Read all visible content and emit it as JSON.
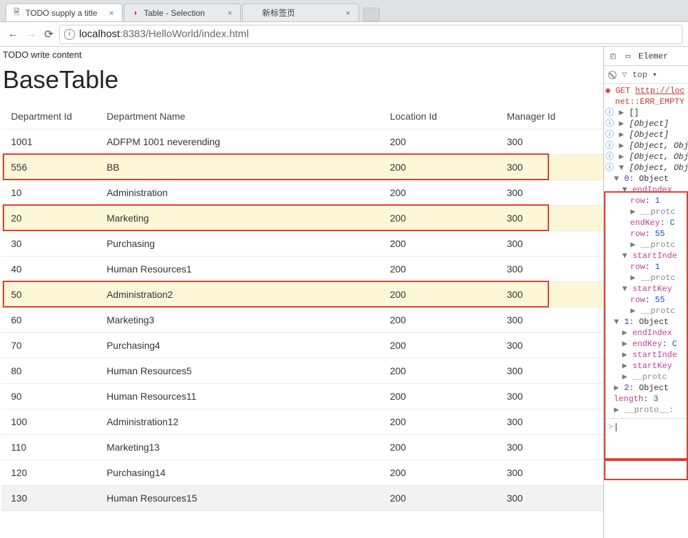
{
  "browser": {
    "tabs": [
      {
        "title": "TODO supply a title",
        "favicon": "doc",
        "active": true
      },
      {
        "title": "Table - Selection",
        "favicon": "oracle",
        "active": false
      },
      {
        "title": "新标签页",
        "favicon": "",
        "active": false
      }
    ],
    "url_host": "localhost",
    "url_port": ":8383",
    "url_path": "/HelloWorld/index.html"
  },
  "page": {
    "pre_text": "TODO write content",
    "heading": "BaseTable",
    "columns": [
      "Department Id",
      "Department Name",
      "Location Id",
      "Manager Id"
    ],
    "rows": [
      {
        "id": "1001",
        "name": "ADFPM 1001 neverending",
        "loc": "200",
        "mgr": "300",
        "selected": false
      },
      {
        "id": "556",
        "name": "BB",
        "loc": "200",
        "mgr": "300",
        "selected": true
      },
      {
        "id": "10",
        "name": "Administration",
        "loc": "200",
        "mgr": "300",
        "selected": false
      },
      {
        "id": "20",
        "name": "Marketing",
        "loc": "200",
        "mgr": "300",
        "selected": true
      },
      {
        "id": "30",
        "name": "Purchasing",
        "loc": "200",
        "mgr": "300",
        "selected": false
      },
      {
        "id": "40",
        "name": "Human Resources1",
        "loc": "200",
        "mgr": "300",
        "selected": false
      },
      {
        "id": "50",
        "name": "Administration2",
        "loc": "200",
        "mgr": "300",
        "selected": true
      },
      {
        "id": "60",
        "name": "Marketing3",
        "loc": "200",
        "mgr": "300",
        "selected": false
      },
      {
        "id": "70",
        "name": "Purchasing4",
        "loc": "200",
        "mgr": "300",
        "selected": false
      },
      {
        "id": "80",
        "name": "Human Resources5",
        "loc": "200",
        "mgr": "300",
        "selected": false
      },
      {
        "id": "90",
        "name": "Human Resources11",
        "loc": "200",
        "mgr": "300",
        "selected": false
      },
      {
        "id": "100",
        "name": "Administration12",
        "loc": "200",
        "mgr": "300",
        "selected": false
      },
      {
        "id": "110",
        "name": "Marketing13",
        "loc": "200",
        "mgr": "300",
        "selected": false
      },
      {
        "id": "120",
        "name": "Purchasing14",
        "loc": "200",
        "mgr": "300",
        "selected": false
      },
      {
        "id": "130",
        "name": "Human Resources15",
        "loc": "200",
        "mgr": "300",
        "selected": false,
        "hovered": true
      }
    ]
  },
  "devtools": {
    "tabs_label": "Elemer",
    "filter_scope": "top",
    "error": {
      "method": "GET",
      "url": "http://loc",
      "net": "net::ERR_EMPTY"
    },
    "lines": [
      {
        "tw": "▶",
        "txt": "[]"
      },
      {
        "tw": "▶",
        "txt": "[Object]",
        "it": true
      },
      {
        "tw": "▶",
        "txt": "[Object]",
        "it": true
      },
      {
        "tw": "▶",
        "txt": "[Object, Obj",
        "it": true
      },
      {
        "tw": "▶",
        "txt": "[Object, Obj",
        "it": true
      }
    ],
    "expanded": {
      "head": "[Object, Obj",
      "obj0": {
        "label": "0: Object",
        "rows": [
          {
            "key": "endIndex",
            "extra": ""
          },
          {
            "key": "row",
            "val": "1"
          },
          {
            "key": "__protc",
            "grey": true
          },
          {
            "key": "endKey",
            "val": "C"
          },
          {
            "key": "row",
            "val": "55"
          },
          {
            "key": "__protc",
            "grey": true
          },
          {
            "key": "startInde",
            "extra": ""
          },
          {
            "key": "row",
            "val": "1"
          },
          {
            "key": "__protc",
            "grey": true
          },
          {
            "key": "startKey",
            "extra": ""
          },
          {
            "key": "row",
            "val": "55"
          },
          {
            "key": "__protc",
            "grey": true
          }
        ]
      },
      "obj1": {
        "label": "1: Object",
        "rows": [
          {
            "key": "endIndex",
            "extra": ""
          },
          {
            "key": "endKey",
            "val": "C"
          },
          {
            "key": "startInde",
            "extra": ""
          },
          {
            "key": "startKey",
            "extra": ""
          },
          {
            "key": "__protc",
            "grey": true
          }
        ]
      },
      "obj2_label": "2: Object",
      "length_label": "length",
      "length_val": "3",
      "proto_label": "__proto__:"
    },
    "prompt": ">"
  }
}
